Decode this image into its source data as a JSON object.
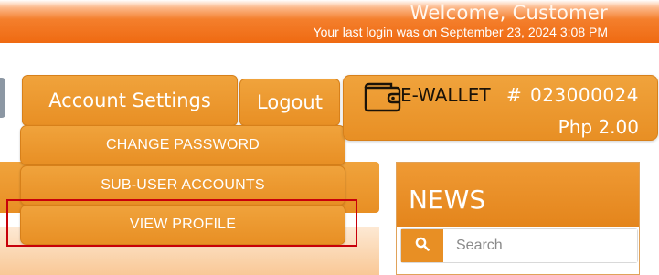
{
  "header": {
    "welcome": "Welcome, Customer",
    "last_login": "Your last login was on September 23, 2024 3:08 PM"
  },
  "nav": {
    "account_settings": "Account Settings",
    "logout": "Logout"
  },
  "account_menu": [
    {
      "label": "CHANGE PASSWORD"
    },
    {
      "label": "SUB-USER ACCOUNTS"
    },
    {
      "label": "VIEW PROFILE"
    }
  ],
  "ewallet": {
    "label": "E-WALLET",
    "hash": "#",
    "number": "023000024",
    "balance": "Php 2.00",
    "icon": "wallet-icon"
  },
  "news": {
    "title": "NEWS",
    "search_placeholder": "Search",
    "search_icon": "search-icon"
  },
  "colors": {
    "accent": "#e88f24",
    "header": "#ef6a12",
    "highlight": "#c8000a"
  }
}
